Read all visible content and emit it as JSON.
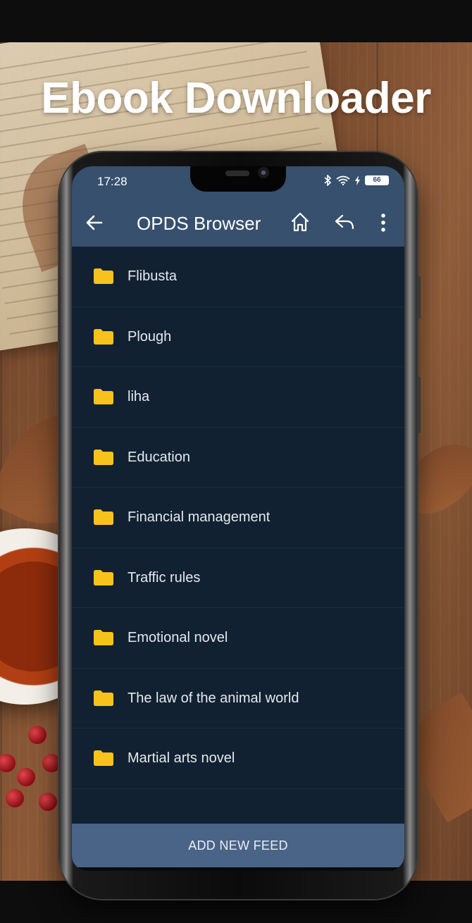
{
  "promo": {
    "headline": "Ebook Downloader"
  },
  "status_bar": {
    "time": "17:28",
    "battery": "66",
    "icons": [
      "bluetooth-icon",
      "wifi-icon",
      "charging-icon",
      "battery-icon"
    ]
  },
  "app_bar": {
    "title": "OPDS Browser",
    "icons": [
      "back-arrow-icon",
      "home-icon",
      "reply-icon",
      "more-vert-icon"
    ]
  },
  "feeds": [
    {
      "label": "Flibusta",
      "icon": "folder-icon"
    },
    {
      "label": "Plough",
      "icon": "folder-icon"
    },
    {
      "label": "liha",
      "icon": "folder-icon"
    },
    {
      "label": "Education",
      "icon": "folder-icon"
    },
    {
      "label": "Financial management",
      "icon": "folder-icon"
    },
    {
      "label": "Traffic rules",
      "icon": "folder-icon"
    },
    {
      "label": "Emotional novel",
      "icon": "folder-icon"
    },
    {
      "label": "The law of the animal world",
      "icon": "folder-icon"
    },
    {
      "label": "Martial arts novel",
      "icon": "folder-icon"
    }
  ],
  "footer": {
    "add_feed_label": "ADD NEW FEED"
  },
  "colors": {
    "app_bar": "#36506d",
    "list_background": "#112131",
    "folder": "#f7c21c",
    "footer": "#4a6488"
  }
}
